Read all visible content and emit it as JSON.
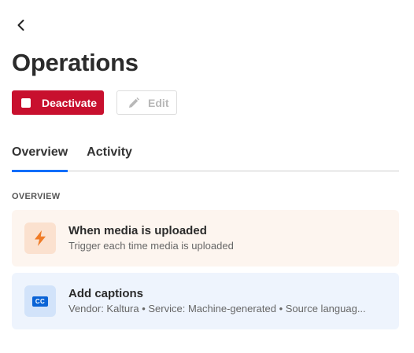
{
  "header": {
    "back_icon": "chevron-left-icon",
    "title": "Operations"
  },
  "actions": {
    "deactivate_label": "Deactivate",
    "deactivate_icon": "stop-icon",
    "edit_label": "Edit",
    "edit_icon": "pencil-icon",
    "edit_disabled": true
  },
  "tabs": [
    {
      "label": "Overview",
      "active": true
    },
    {
      "label": "Activity",
      "active": false
    }
  ],
  "overview": {
    "section_label": "OVERVIEW",
    "trigger": {
      "icon": "lightning-icon",
      "title": "When media is uploaded",
      "subtitle": "Trigger each time media is uploaded"
    },
    "action": {
      "icon": "closed-captions-icon",
      "icon_text": "CC",
      "title": "Add captions",
      "subtitle": "Vendor: Kaltura • Service: Machine-generated • Source languag..."
    }
  },
  "colors": {
    "deactivate": "#c8102e",
    "tab_active": "#006efa",
    "trigger_card": "#fdf5ef",
    "trigger_icon": "#f07b26",
    "action_card": "#eef4fd",
    "action_icon": "#0a63d6"
  }
}
